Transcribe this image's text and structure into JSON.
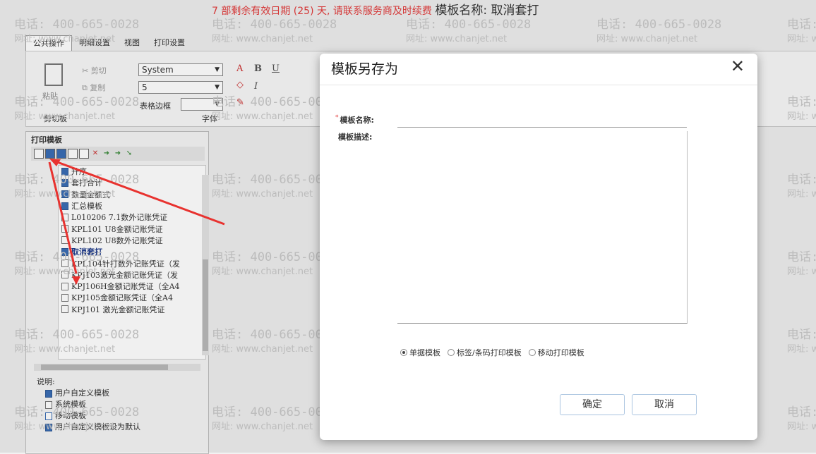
{
  "top_note": {
    "red": "7 部剩余有效日期 (25) 天, 请联系服务商及时续费",
    "dark": "模板名称: 取消套打"
  },
  "tabs": [
    "公共操作",
    "明细设置",
    "视图",
    "打印设置"
  ],
  "ribbon": {
    "paste": "粘贴",
    "cut": "剪切",
    "copy": "复制",
    "clipboard_group": "剪切板",
    "font_family": "System",
    "font_size": "5",
    "border_label": "表格边框",
    "font_group": "字体",
    "bold": "B",
    "italic": "I",
    "underline": "U"
  },
  "panel": {
    "title": "打印模板",
    "tree": [
      {
        "label": "升序",
        "icon": "user-template-icon"
      },
      {
        "label": "套打合计",
        "icon": "user-template-icon"
      },
      {
        "label": "数量金额式",
        "icon": "user-template-icon"
      },
      {
        "label": "汇总模板",
        "icon": "user-template-icon"
      },
      {
        "label": "L010206 7.1数外记账凭证",
        "icon": "system-template-icon"
      },
      {
        "label": "KPL101 U8金额记账凭证",
        "icon": "system-template-icon"
      },
      {
        "label": "KPL102 U8数外记账凭证",
        "icon": "system-template-icon"
      },
      {
        "label": "取消套打",
        "icon": "user-template-icon",
        "selected": true
      },
      {
        "label": "KPL104针打数外记账凭证（发",
        "icon": "system-template-icon"
      },
      {
        "label": "KPJ103激光金额记账凭证（发",
        "icon": "system-template-icon"
      },
      {
        "label": "KPJ106H金额记账凭证（全A4",
        "icon": "system-template-icon"
      },
      {
        "label": "KPJ105金额记账凭证（全A4",
        "icon": "system-template-icon"
      },
      {
        "label": "KPJ101 激光金额记账凭证",
        "icon": "system-template-icon"
      }
    ],
    "legend_title": "说明:",
    "legend": [
      "用户自定义模板",
      "系统模板",
      "移动模板",
      "用户自定义模板设为默认"
    ]
  },
  "watermark": {
    "phone": "电话: 400-665-0028",
    "site": "网址: www.chanjet.net"
  },
  "modal": {
    "title": "模板另存为",
    "close": "✕",
    "name_label": "模板名称:",
    "name_value": "",
    "desc_label": "模板描述:",
    "desc_value": "",
    "radio_options": [
      {
        "label": "单据模板",
        "checked": true
      },
      {
        "label": "标签/条码打印模板",
        "checked": false
      },
      {
        "label": "移动打印模板",
        "checked": false
      }
    ],
    "ok": "确定",
    "cancel": "取消"
  }
}
